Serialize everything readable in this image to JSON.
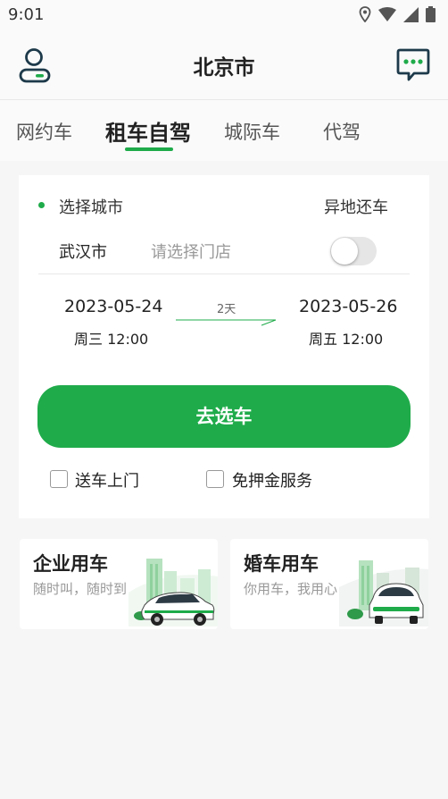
{
  "status_bar": {
    "time": "9:01",
    "icons": [
      "location-icon",
      "wifi-icon",
      "signal-icon",
      "battery-icon"
    ]
  },
  "header": {
    "title": "北京市",
    "left_icon": "profile-icon",
    "right_icon": "message-icon"
  },
  "tabs": [
    {
      "label": "网约车",
      "active": false
    },
    {
      "label": "租车自驾",
      "active": true
    },
    {
      "label": "城际车",
      "active": false
    },
    {
      "label": "代驾",
      "active": false
    }
  ],
  "rental": {
    "select_city": "选择城市",
    "return_other": "异地还车",
    "city": "武汉市",
    "store_placeholder": "请选择门店",
    "return_other_enabled": false,
    "pickup": {
      "date": "2023-05-24",
      "time": "周三 12:00"
    },
    "duration": "2天",
    "dropoff": {
      "date": "2023-05-26",
      "time": "周五 12:00"
    },
    "button": "去选车",
    "options": [
      {
        "label": "送车上门",
        "checked": false
      },
      {
        "label": "免押金服务",
        "checked": false
      }
    ]
  },
  "promos": [
    {
      "title": "企业用车",
      "desc": "随时叫，随时到"
    },
    {
      "title": "婚车用车",
      "desc": "你用车，我用心"
    }
  ],
  "colors": {
    "accent": "#1fab4a",
    "background": "#f6f6f6",
    "card": "#ffffff",
    "muted_text": "#999999"
  }
}
